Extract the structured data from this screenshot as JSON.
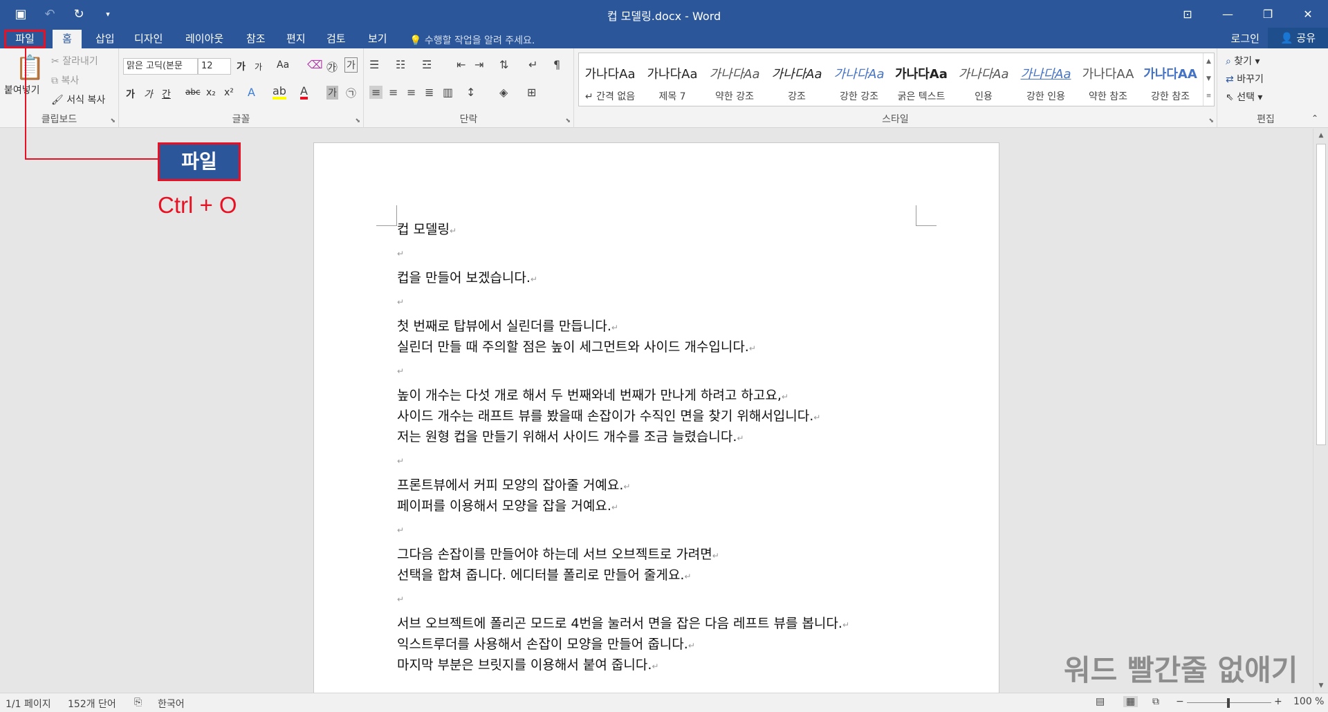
{
  "titlebar": {
    "title": "컵 모델링.docx - Word",
    "qat": [
      {
        "icon": "save-icon",
        "glyph": "💾"
      },
      {
        "icon": "undo-icon",
        "glyph": "↶"
      },
      {
        "icon": "redo-icon",
        "glyph": "↻"
      },
      {
        "icon": "customize-qat-icon",
        "glyph": "▾"
      }
    ],
    "window_buttons": [
      {
        "icon": "ribbon-display-icon",
        "glyph": "⊡"
      },
      {
        "icon": "minimize-icon",
        "glyph": "—"
      },
      {
        "icon": "restore-icon",
        "glyph": "❐"
      },
      {
        "icon": "close-icon",
        "glyph": "✕"
      }
    ]
  },
  "tabs": {
    "file": "파일",
    "home": "홈",
    "insert": "삽입",
    "design": "디자인",
    "layout": "레이아웃",
    "references": "참조",
    "mailings": "편지",
    "review": "검토",
    "view": "보기",
    "tell_me": "💡 수행할 작업을 알려 주세요.",
    "login": "로그인",
    "share": "👤 공유"
  },
  "ribbon": {
    "clipboard": {
      "label": "클립보드",
      "paste": "붙여넣기",
      "cut": "잘라내기",
      "copy": "복사",
      "format_painter": "서식 복사"
    },
    "font": {
      "label": "글꼴",
      "font_name": "맑은 고딕(본문",
      "font_size": "12",
      "grow": "가",
      "shrink": "가",
      "change_case": "Aa",
      "bold": "가",
      "italic": "가",
      "underline": "간",
      "strike": "abc",
      "subscript": "x₂",
      "superscript": "x²"
    },
    "paragraph": {
      "label": "단락"
    },
    "styles": {
      "label": "스타일",
      "items": [
        {
          "preview": "가나다Aa",
          "name": "↵ 간격 없음"
        },
        {
          "preview": "가나다Aa",
          "name": "제목 7"
        },
        {
          "preview": "가나다Aa",
          "name": "약한 강조"
        },
        {
          "preview": "가나다Aa",
          "name": "강조"
        },
        {
          "preview": "가나다Aa",
          "name": "강한 강조"
        },
        {
          "preview": "가나다Aa",
          "name": "굵은 텍스트"
        },
        {
          "preview": "가나다Aa",
          "name": "인용"
        },
        {
          "preview": "가나다Aa",
          "name": "강한 인용"
        },
        {
          "preview": "가나다AA",
          "name": "약한 참조"
        },
        {
          "preview": "가나다AA",
          "name": "강한 참조"
        }
      ]
    },
    "editing": {
      "label": "편집",
      "find": "찾기",
      "replace": "바꾸기",
      "select": "선택"
    }
  },
  "document": {
    "paragraphs": [
      "컵 모델링",
      "",
      "컵을 만들어 보겠습니다.",
      "",
      "첫 번째로 탑뷰에서 실린더를  만듭니다.",
      "실린더 만들 때 주의할 점은 높이  세그먼트와 사이드 개수입니다.",
      "",
      "높이 개수는 다섯 개로 해서 두 번째와네 번째가 만나게 하려고 하고요,",
      "사이드 개수는 래프트 뷰를 봤을때  손잡이가 수직인 면을 찾기 위해서입니다.",
      "저는 원형 컵을 만들기 위해서 사이드 개수를  조금 늘렸습니다.",
      "",
      "프론트뷰에서 커피 모양의 잡아줄 거예요.",
      "페이퍼를 이용해서 모양을 잡을 거예요.",
      "",
      "그다음 손잡이를  만들어야 하는데 서브 오브젝트로  가려면",
      " 선택을 합쳐 줍니다.  에디터블 폴리로 만들어 줄게요.",
      "",
      " 서브 오브젝트에 폴리곤 모드로 4번을 눌러서 면을 잡은 다음 레프트 뷰를 봅니다.",
      "익스트루더를 사용해서 손잡이 모양을 만들어 줍니다.",
      " 마지막 부분은 브릿지를 이용해서 붙여 줍니다."
    ]
  },
  "statusbar": {
    "page": "1/1 페이지",
    "words": "152개 단어",
    "language": "한국어",
    "zoom": "100 %"
  },
  "annotation": {
    "file_box": "파일",
    "shortcut": "Ctrl + O",
    "watermark": "워드 빨간줄 없애기"
  },
  "colors": {
    "accent": "#2b579a",
    "annotation": "#e81123"
  }
}
